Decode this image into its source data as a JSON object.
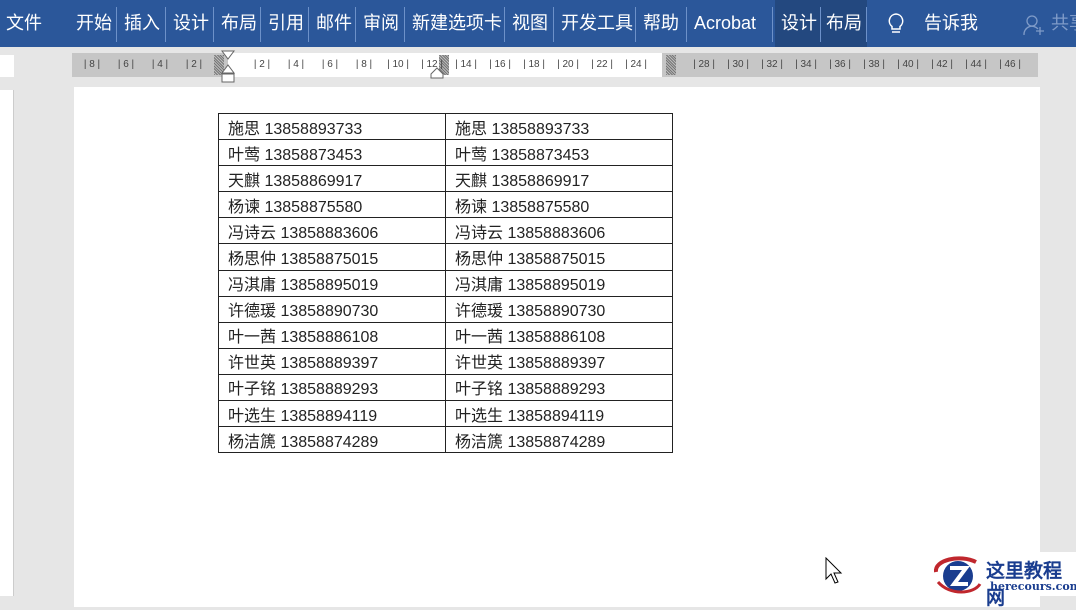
{
  "ribbon": {
    "tabs": [
      "文件",
      "开始",
      "插入",
      "设计",
      "布局",
      "引用",
      "邮件",
      "审阅",
      "新建选项卡",
      "视图",
      "开发工具",
      "帮助",
      "Acrobat"
    ],
    "context_tabs": [
      "设计",
      "布局"
    ],
    "tell_me": "告诉我",
    "share": "共享"
  },
  "ruler": {
    "left_labels": [
      "8",
      "6",
      "4",
      "2"
    ],
    "right_labels": [
      "2",
      "4",
      "6",
      "8",
      "10",
      "12",
      "14",
      "16",
      "18",
      "20",
      "22",
      "24",
      "",
      "28",
      "30",
      "32",
      "34",
      "36",
      "38",
      "40",
      "42",
      "44",
      "46"
    ]
  },
  "table": {
    "rows": [
      [
        "施思 13858893733",
        "施思 13858893733"
      ],
      [
        "叶莺 13858873453",
        "叶莺 13858873453"
      ],
      [
        "天麒 13858869917",
        "天麒 13858869917"
      ],
      [
        "杨谏 13858875580",
        "杨谏 13858875580"
      ],
      [
        "冯诗云 13858883606",
        "冯诗云 13858883606"
      ],
      [
        "杨思仲 13858875015",
        "杨思仲 13858875015"
      ],
      [
        "冯淇庸 13858895019",
        "冯淇庸 13858895019"
      ],
      [
        "许德瑗 13858890730",
        "许德瑗 13858890730"
      ],
      [
        "叶一茜 13858886108",
        "叶一茜 13858886108"
      ],
      [
        "许世英 13858889397",
        "许世英 13858889397"
      ],
      [
        "叶子铭 13858889293",
        "叶子铭 13858889293"
      ],
      [
        "叶选生 13858894119",
        "叶选生 13858894119"
      ],
      [
        "杨洁篪 13858874289",
        "杨洁篪 13858874289"
      ]
    ]
  },
  "watermark": {
    "cn": "这里教程网",
    "en": "herecours.com"
  }
}
